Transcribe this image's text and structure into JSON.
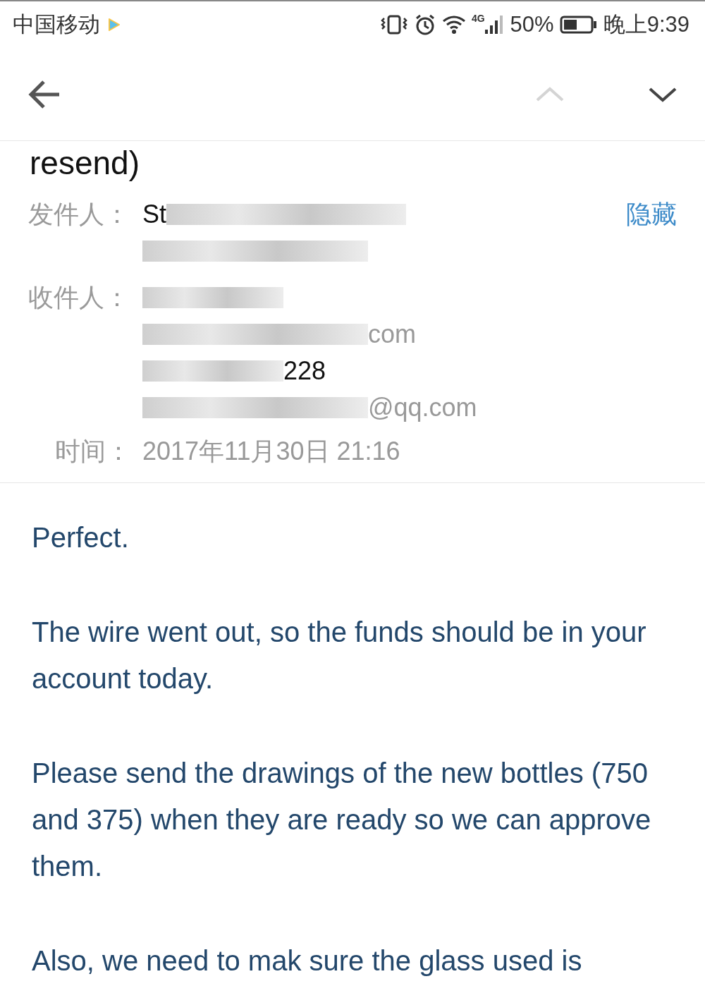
{
  "status_bar": {
    "carrier": "中国移动",
    "battery": "50%",
    "network": "4G",
    "time": "晚上9:39"
  },
  "toolbar": {
    "previous_disabled": true,
    "next_disabled": false
  },
  "subject": "resend)",
  "header": {
    "hide_link": "隐藏",
    "from_label": "发件人：",
    "from_lines": [
      {
        "text": "St",
        "redacted": true
      },
      {
        "redacted": true
      }
    ],
    "to_label": "收件人：",
    "to_lines": [
      {
        "redacted": true
      },
      {
        "text": "com",
        "redacted": true
      },
      {
        "text": "228",
        "redacted": true
      },
      {
        "text": "@qq.com",
        "redacted": true
      }
    ],
    "time_label": "时间：",
    "time": "2017年11月30日 21:16"
  },
  "body": [
    "Perfect.",
    "The wire went out, so the funds should be in your account today.",
    "Please send the drawings of the new bottles (750 and 375) when they are ready so we can approve them.",
    "Also, we need to mak  sure the glass used is"
  ]
}
